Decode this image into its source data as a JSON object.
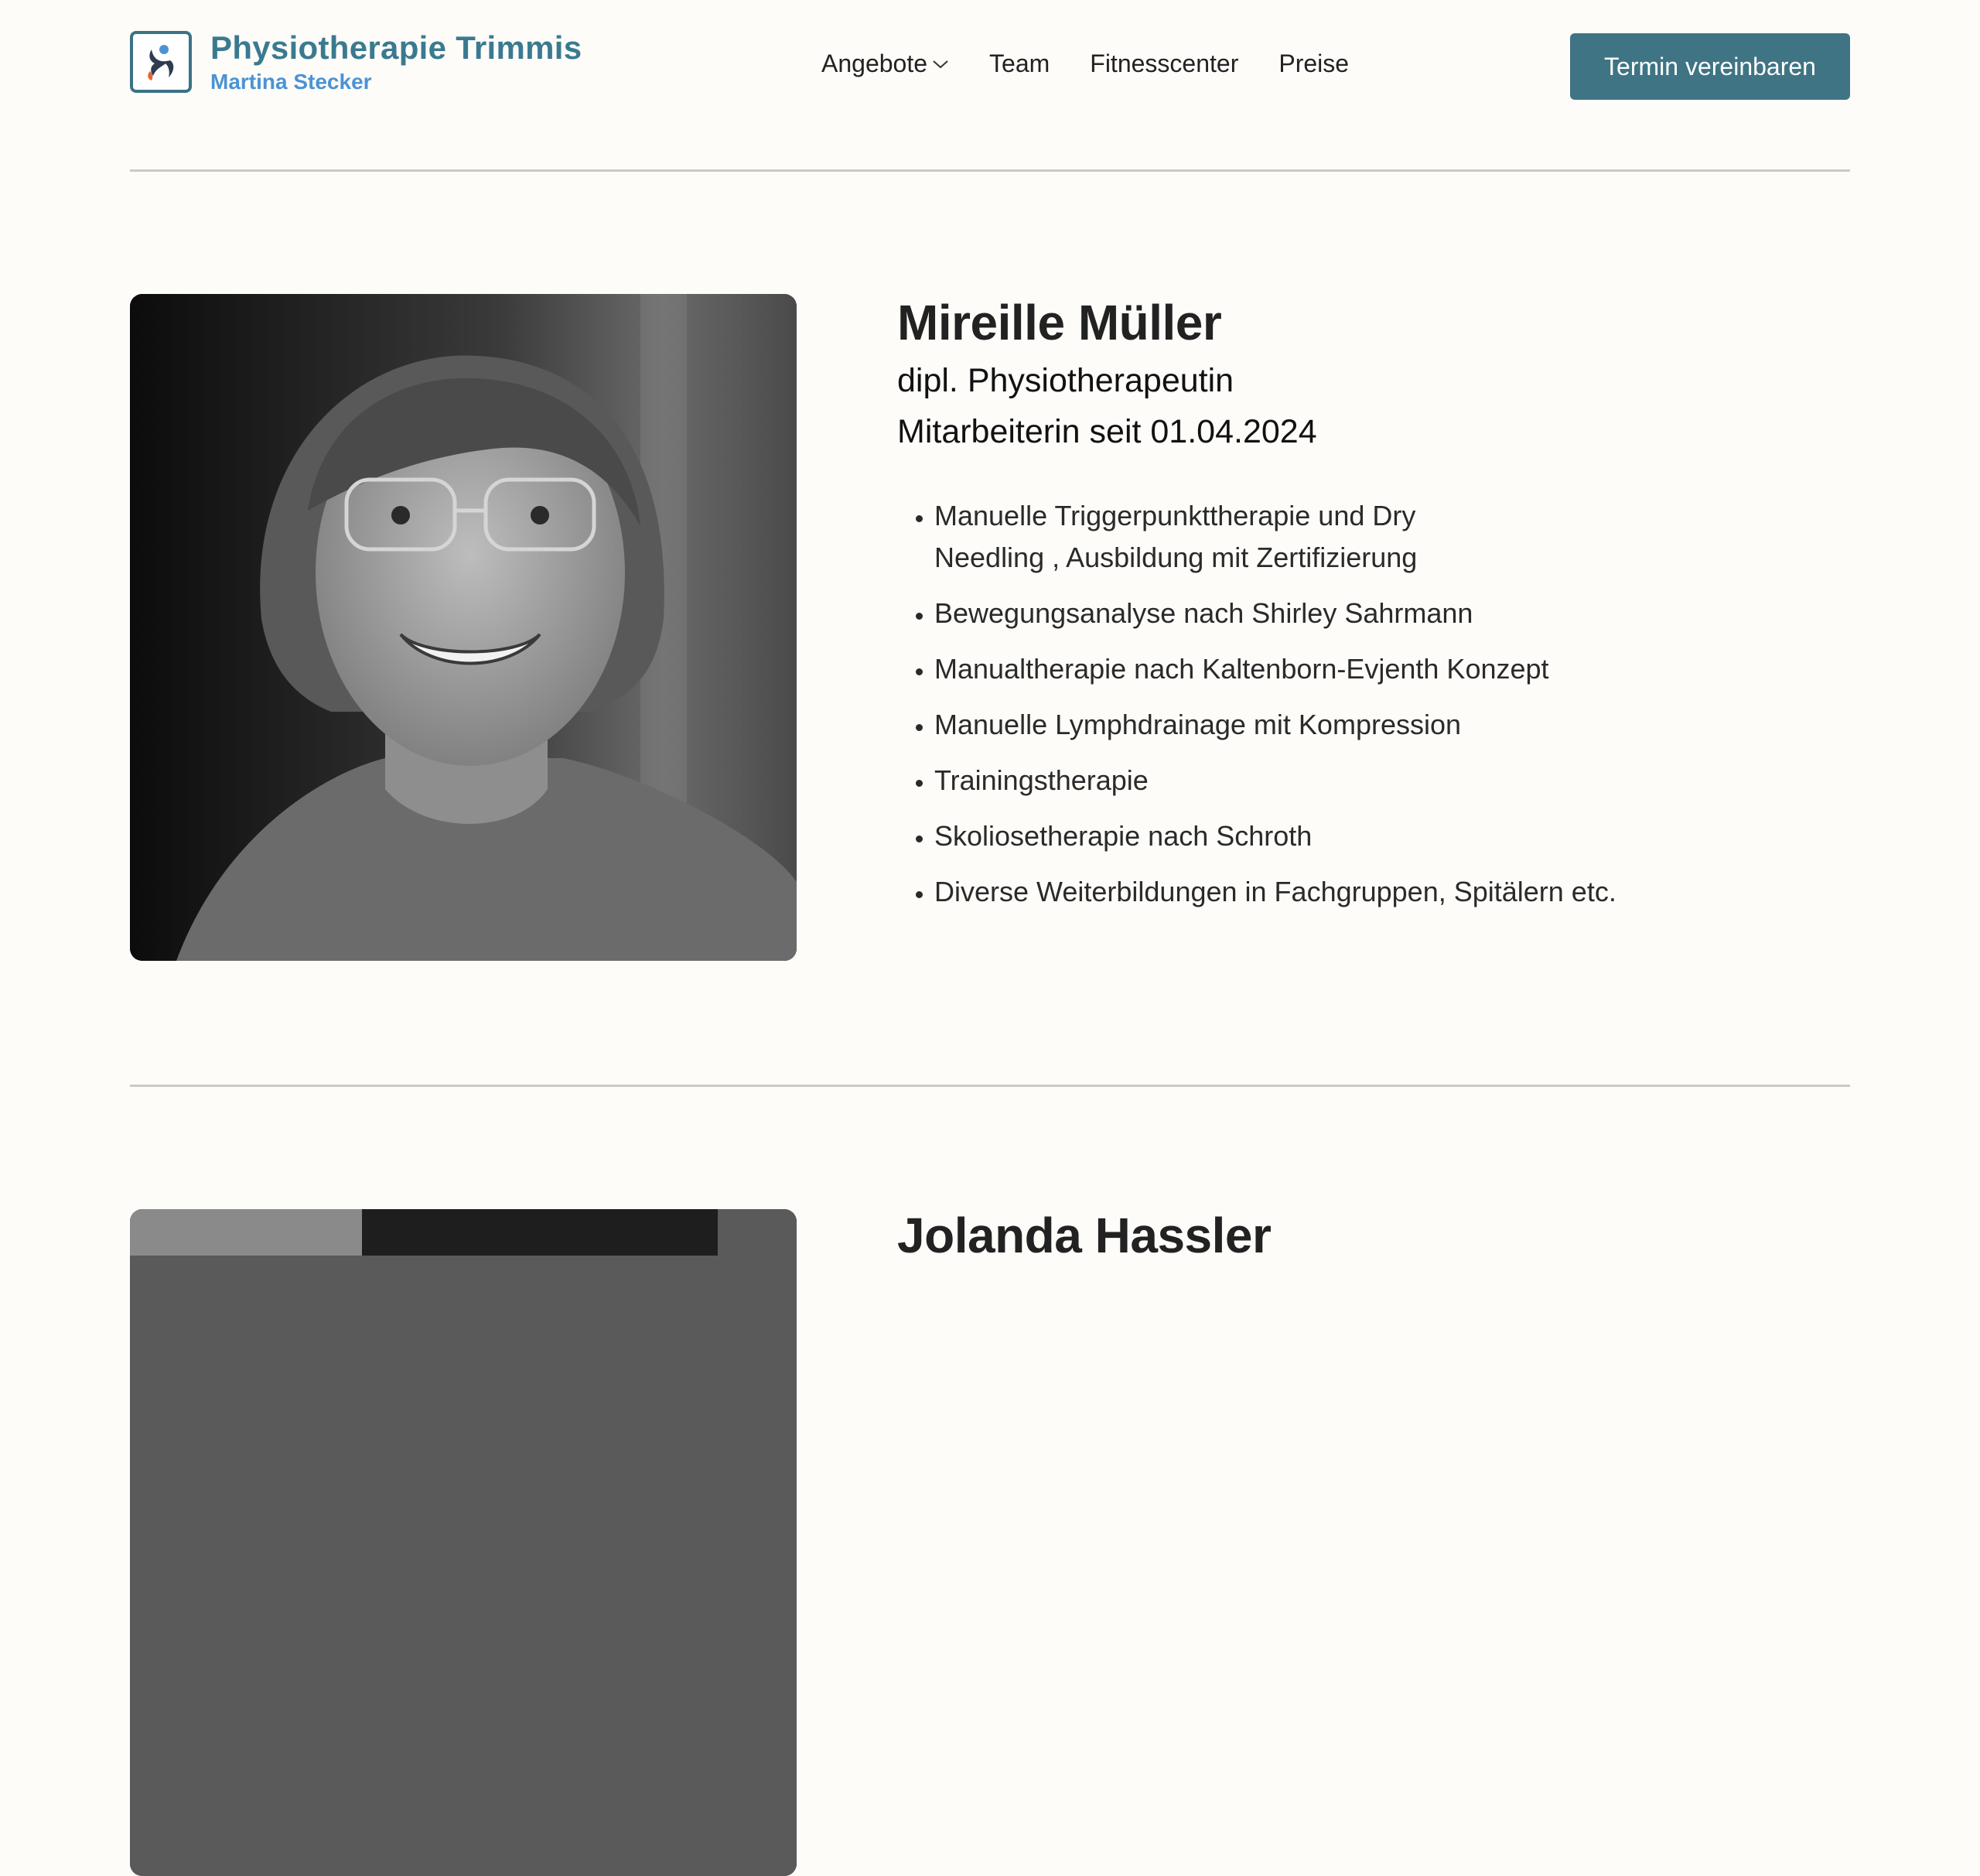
{
  "header": {
    "brand": "Physiotherapie Trimmis",
    "brand_sub": "Martina Stecker",
    "nav": [
      {
        "label": "Angebote",
        "has_dropdown": true
      },
      {
        "label": "Team"
      },
      {
        "label": "Fitnesscenter"
      },
      {
        "label": "Preise"
      }
    ],
    "cta_label": "Termin vereinbaren"
  },
  "colors": {
    "brand": "#3a7a90",
    "brand_sub": "#4b93d4",
    "cta_bg": "#3f7484",
    "page_bg": "#fdfcf9"
  },
  "profiles": [
    {
      "name": "Mireille Müller",
      "title": "dipl. Physiotherapeutin",
      "since": "Mitarbeiterin seit 01.04.2024",
      "photo_icon": "portrait-photo-bw",
      "qualifications": [
        "Manuelle Triggerpunkttherapie und Dry Needling , Ausbildung mit Zertifizierung",
        "Bewegungsanalyse nach Shirley Sahrmann",
        "Manualtherapie nach Kaltenborn-Evjenth Konzept",
        "Manuelle Lymphdrainage mit Kompression",
        "Trainingstherapie",
        "Skoliosetherapie nach Schroth",
        "Diverse Weiterbildungen in Fachgruppen, Spitälern etc."
      ]
    },
    {
      "name": "Jolanda Hassler",
      "photo_icon": "portrait-photo-bw"
    }
  ]
}
